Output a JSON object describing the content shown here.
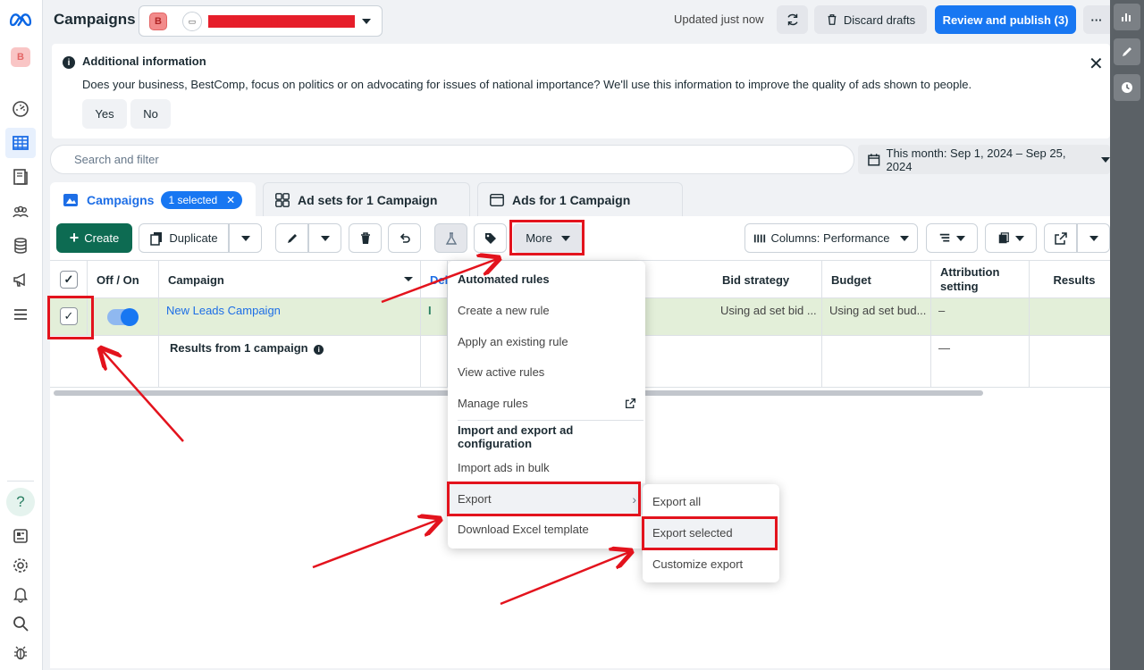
{
  "app": {
    "title": "Campaigns",
    "account_initial": "B",
    "account_icon": "ad-account-icon",
    "account_name_redacted": "████████████████"
  },
  "topbar": {
    "updated": "Updated just now",
    "discard": "Discard drafts",
    "publish": "Review and publish (3)",
    "more": "···"
  },
  "banner": {
    "title": "Additional information",
    "text": "Does your business, BestComp, focus on politics or on advocating for issues of national importance? We'll use this information to improve the quality of ads shown to people.",
    "yes": "Yes",
    "no": "No",
    "close": "✕"
  },
  "filter": {
    "search_placeholder": "Search and filter",
    "date_range": "This month: Sep 1, 2024 – Sep 25, 2024"
  },
  "tabs": [
    {
      "label": "Campaigns",
      "selected_pill": "1 selected"
    },
    {
      "label": "Ad sets for 1 Campaign"
    },
    {
      "label": "Ads for 1 Campaign"
    }
  ],
  "toolbar": {
    "create": "Create",
    "duplicate": "Duplicate",
    "more": "More",
    "columns": "Columns: Performance"
  },
  "table": {
    "headers": {
      "off_on": "Off / On",
      "campaign": "Campaign",
      "delivery_partial": "Deli",
      "bid_strategy": "Bid strategy",
      "budget": "Budget",
      "attribution": "Attribution setting",
      "results": "Results"
    },
    "rows": [
      {
        "campaign": "New Leads Campaign",
        "delivery_partial": "I",
        "bid_strategy": "Using ad set bid ...",
        "budget": "Using ad set bud...",
        "attribution": "–"
      }
    ],
    "summary": {
      "label": "Results from 1 campaign",
      "attribution": "—"
    }
  },
  "more_menu": {
    "section1": "Automated rules",
    "items1": [
      "Create a new rule",
      "Apply an existing rule",
      "View active rules",
      "Manage rules"
    ],
    "section2": "Import and export ad configuration",
    "items2": [
      "Import ads in bulk",
      "Export",
      "Download Excel template"
    ]
  },
  "export_submenu": {
    "items": [
      "Export all",
      "Export selected",
      "Customize export"
    ]
  },
  "colors": {
    "accent_blue": "#1877f2",
    "create_green": "#0d6b52",
    "selected_row": "#e3efd9",
    "annotation_red": "#e3131d"
  }
}
